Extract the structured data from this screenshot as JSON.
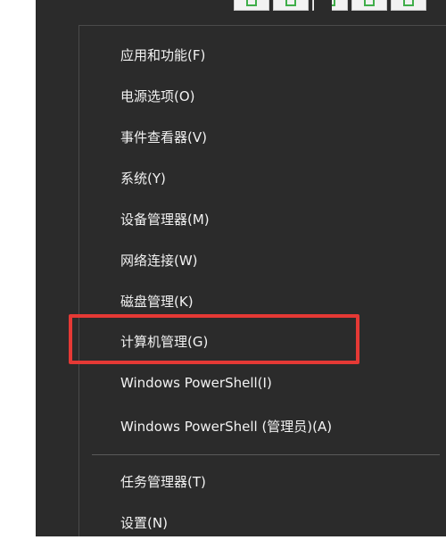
{
  "menu": {
    "items": [
      {
        "label": "应用和功能(F)"
      },
      {
        "label": "电源选项(O)"
      },
      {
        "label": "事件查看器(V)"
      },
      {
        "label": "系统(Y)"
      },
      {
        "label": "设备管理器(M)"
      },
      {
        "label": "网络连接(W)"
      },
      {
        "label": "磁盘管理(K)"
      },
      {
        "label": "计算机管理(G)"
      },
      {
        "label": "Windows PowerShell(I)"
      },
      {
        "label": "Windows PowerShell (管理员)(A)"
      },
      {
        "label": "任务管理器(T)"
      },
      {
        "label": "设置(N)"
      }
    ]
  },
  "colors": {
    "menu_background": "#2b2b2b",
    "menu_text": "#f2f2f2",
    "highlight_border": "#e53935",
    "toolbar_icon": "#3fae49"
  },
  "toolbar": {
    "icons": [
      "toolbar-icon-1",
      "toolbar-icon-2",
      "toolbar-icon-3",
      "toolbar-icon-4",
      "toolbar-icon-5"
    ]
  }
}
